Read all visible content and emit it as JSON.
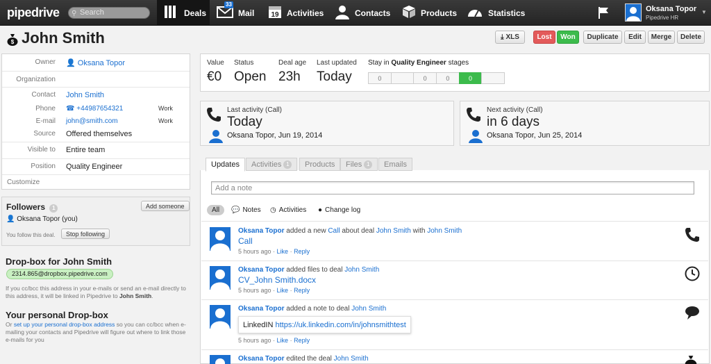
{
  "nav": {
    "logo": "pipedrive",
    "search_placeholder": "Search",
    "items": [
      {
        "label": "Deals",
        "icon": "deals-icon"
      },
      {
        "label": "Mail",
        "icon": "mail-icon",
        "badge": "33"
      },
      {
        "label": "Activities",
        "icon": "calendar-icon",
        "date": "19"
      },
      {
        "label": "Contacts",
        "icon": "person-icon"
      },
      {
        "label": "Products",
        "icon": "box-icon"
      },
      {
        "label": "Statistics",
        "icon": "gauge-icon"
      }
    ],
    "user_name": "Oksana Topor",
    "company": "Pipedrive HR"
  },
  "header": {
    "title": "John Smith",
    "buttons": {
      "xls": "XLS",
      "lost": "Lost",
      "won": "Won",
      "duplicate": "Duplicate",
      "edit": "Edit",
      "merge": "Merge",
      "delete": "Delete"
    }
  },
  "details": {
    "owner_label": "Owner",
    "owner": "Oksana Topor",
    "org_label": "Organization",
    "contact_label": "Contact",
    "contact": "John Smith",
    "phone_label": "Phone",
    "phone": "+44987654321",
    "phone_type": "Work",
    "email_label": "E-mail",
    "email": "john@smith.com",
    "email_type": "Work",
    "source_label": "Source",
    "source": "Offered themselves",
    "visible_label": "Visible to",
    "visible": "Entire team",
    "position_label": "Position",
    "position": "Quality Engineer",
    "customize": "Customize"
  },
  "followers": {
    "title": "Followers",
    "count": "1",
    "add": "Add someone",
    "follower": "Oksana Topor (you)",
    "note": "You follow this deal.",
    "stop": "Stop following"
  },
  "dropbox": {
    "title": "Drop-box for John Smith",
    "address": "2314.865@dropbox.pipedrive.com",
    "desc_1": "If you cc/bcc this address in your e-mails or send an e-mail directly to this address, it will be linked in Pipedrive to ",
    "desc_name": "John Smith",
    "desc_end": ".",
    "personal_title": "Your personal Drop-box",
    "personal_or": "Or ",
    "personal_link": "set up your personal drop-box address",
    "personal_rest": " so you can cc/bcc when e-mailing your contacts and Pipedrive will figure out where to link those e-mails for you"
  },
  "stats": {
    "value_label": "Value",
    "value": "€0",
    "status_label": "Status",
    "status": "Open",
    "age_label": "Deal age",
    "age": "23h",
    "updated_label": "Last updated",
    "updated": "Today",
    "stay_prefix": "Stay in ",
    "stay_stage": "Quality Engineer",
    "stay_suffix": " stages",
    "stages": [
      "0",
      "",
      "0",
      "0",
      "0",
      ""
    ],
    "current_stage_index": 4,
    "accent": "#3cbb4c"
  },
  "activity": {
    "last_label": "Last activity (Call)",
    "last_when": "Today",
    "last_who": "Oksana Topor, Jun 19, 2014",
    "next_label": "Next activity (Call)",
    "next_when": "in 6 days",
    "next_who": "Oksana Topor, Jun 25, 2014"
  },
  "tabs": [
    {
      "label": "Updates"
    },
    {
      "label": "Activities",
      "count": "1"
    },
    {
      "label": "Products"
    },
    {
      "label": "Files",
      "count": "1"
    },
    {
      "label": "Emails"
    }
  ],
  "note_placeholder": "Add a note",
  "filters": [
    "All",
    "Notes",
    "Activities",
    "Change log"
  ],
  "feed": [
    {
      "user": "Oksana Topor",
      "action": " added a new ",
      "link1": "Call",
      "mid": " about deal ",
      "link2": "John Smith",
      "mid2": " with ",
      "link3": "John Smith",
      "object": "Call",
      "time": "5 hours ago",
      "like": "Like",
      "reply": "Reply",
      "icon": "phone-icon"
    },
    {
      "user": "Oksana Topor",
      "action": " added files to deal ",
      "link1": "John Smith",
      "object": "CV_John Smith.docx",
      "time": "5 hours ago",
      "like": "Like",
      "reply": "Reply",
      "icon": "clock-icon"
    },
    {
      "user": "Oksana Topor",
      "action": " added a note to deal ",
      "link1": "John Smith",
      "note_prefix": "LinkedIN ",
      "note_link": "https://uk.linkedin.com/in/johnsmithtest",
      "time": "5 hours ago",
      "like": "Like",
      "reply": "Reply",
      "icon": "speech-bubble-icon"
    },
    {
      "user": "Oksana Topor",
      "action": " edited the deal ",
      "link1": "John Smith",
      "icon": "money-bag-icon"
    }
  ]
}
